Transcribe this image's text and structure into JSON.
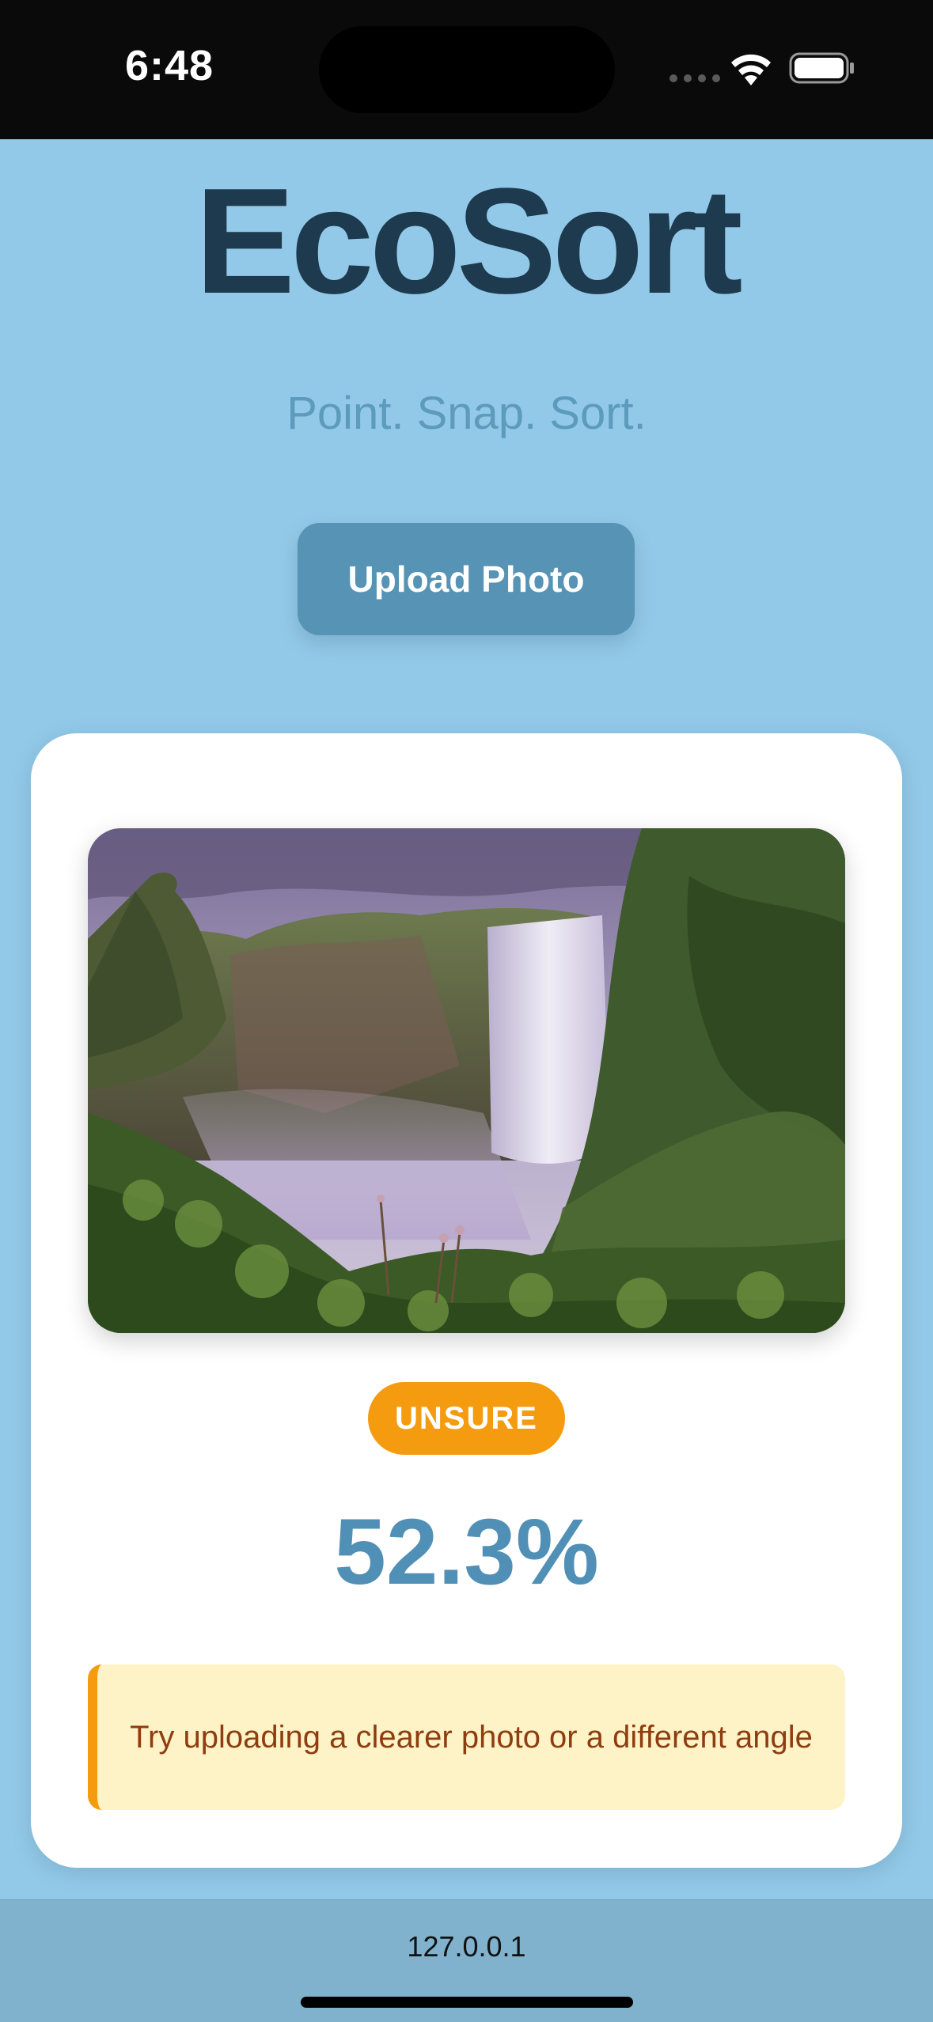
{
  "status_bar": {
    "time": "6:48"
  },
  "header": {
    "title": "EcoSort",
    "tagline": "Point. Snap. Sort."
  },
  "actions": {
    "upload_label": "Upload Photo"
  },
  "result": {
    "photo_subject": "waterfall landscape",
    "label": "UNSURE",
    "confidence": "52.3%",
    "hint": "Try uploading a clearer photo or a different angle"
  },
  "browser": {
    "url": "127.0.0.1"
  },
  "colors": {
    "background": "#93c9e8",
    "title": "#1d3a4e",
    "accent": "#5793b4",
    "warning": "#f49b0f",
    "hint_background": "#fef3c6",
    "hint_text": "#8e3d11"
  }
}
